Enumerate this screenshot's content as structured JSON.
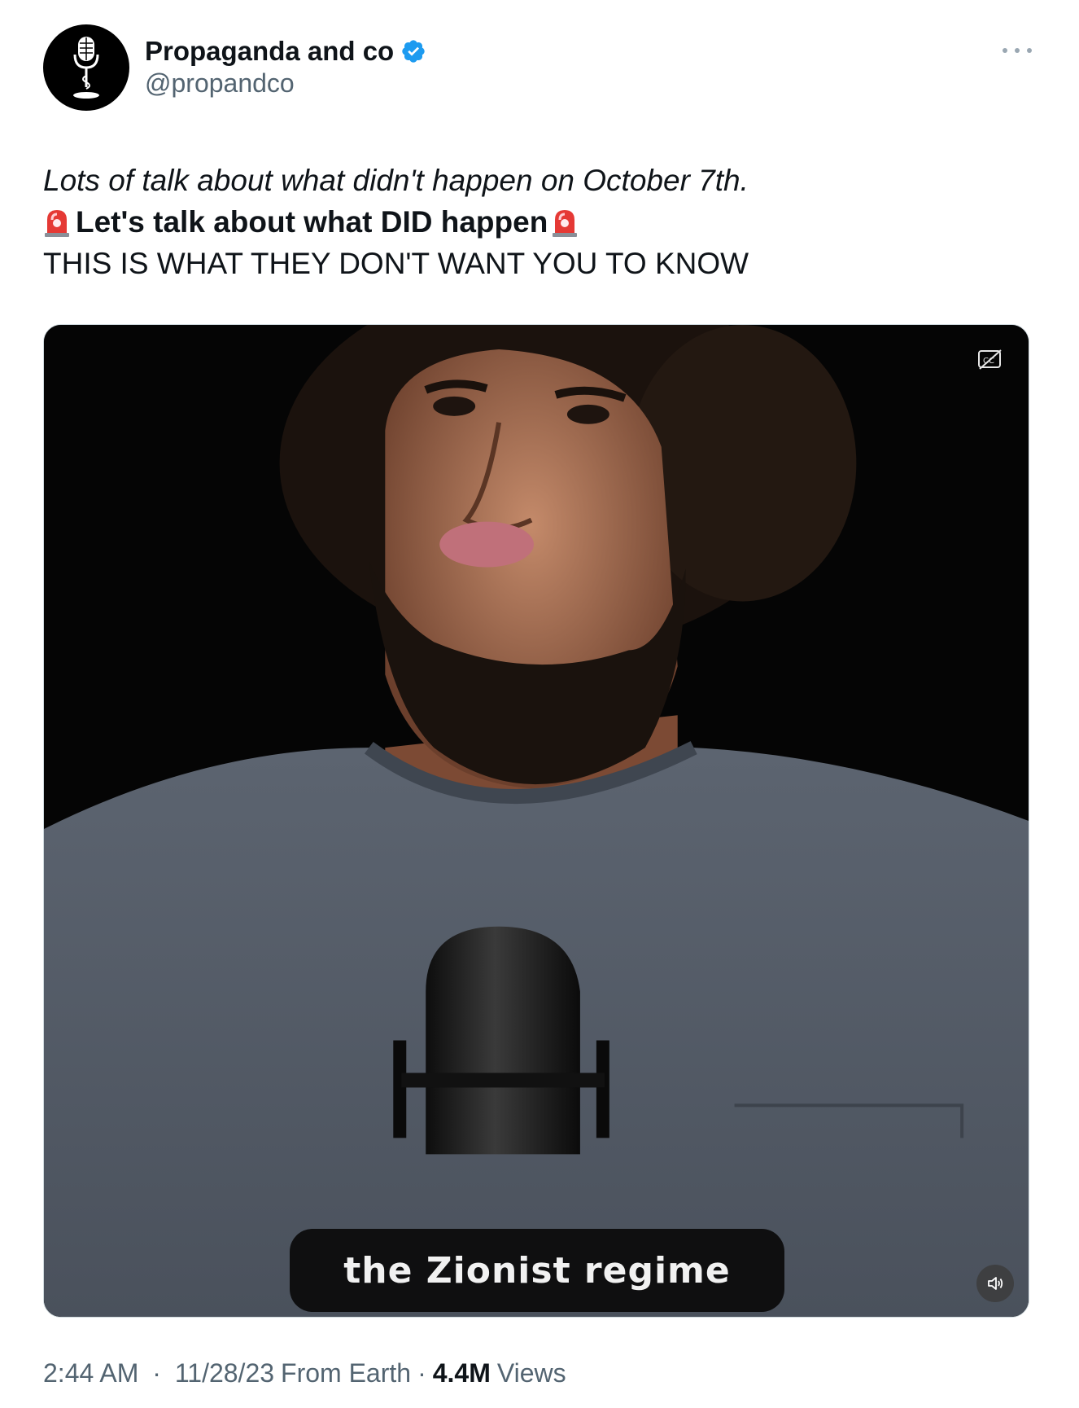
{
  "header": {
    "display_name": "Propaganda and co",
    "handle": "@propandco"
  },
  "tweet": {
    "line1": "Lots of talk about what didn't happen on October 7th.",
    "line2": "Let's talk about what DID happen",
    "line3": "THIS IS WHAT THEY DON'T WANT YOU TO KNOW"
  },
  "media": {
    "caption": "the Zionist regime",
    "cc_icon": "closed-captions-off-icon",
    "volume_icon": "volume-icon"
  },
  "meta": {
    "time": "2:44 AM",
    "date": "11/28/23",
    "source": "From Earth",
    "views_count": "4.4M",
    "views_label": "Views",
    "separator": "·"
  },
  "colors": {
    "verified_blue": "#1d9bf0",
    "text_primary": "#0f1419",
    "text_secondary": "#536471"
  }
}
